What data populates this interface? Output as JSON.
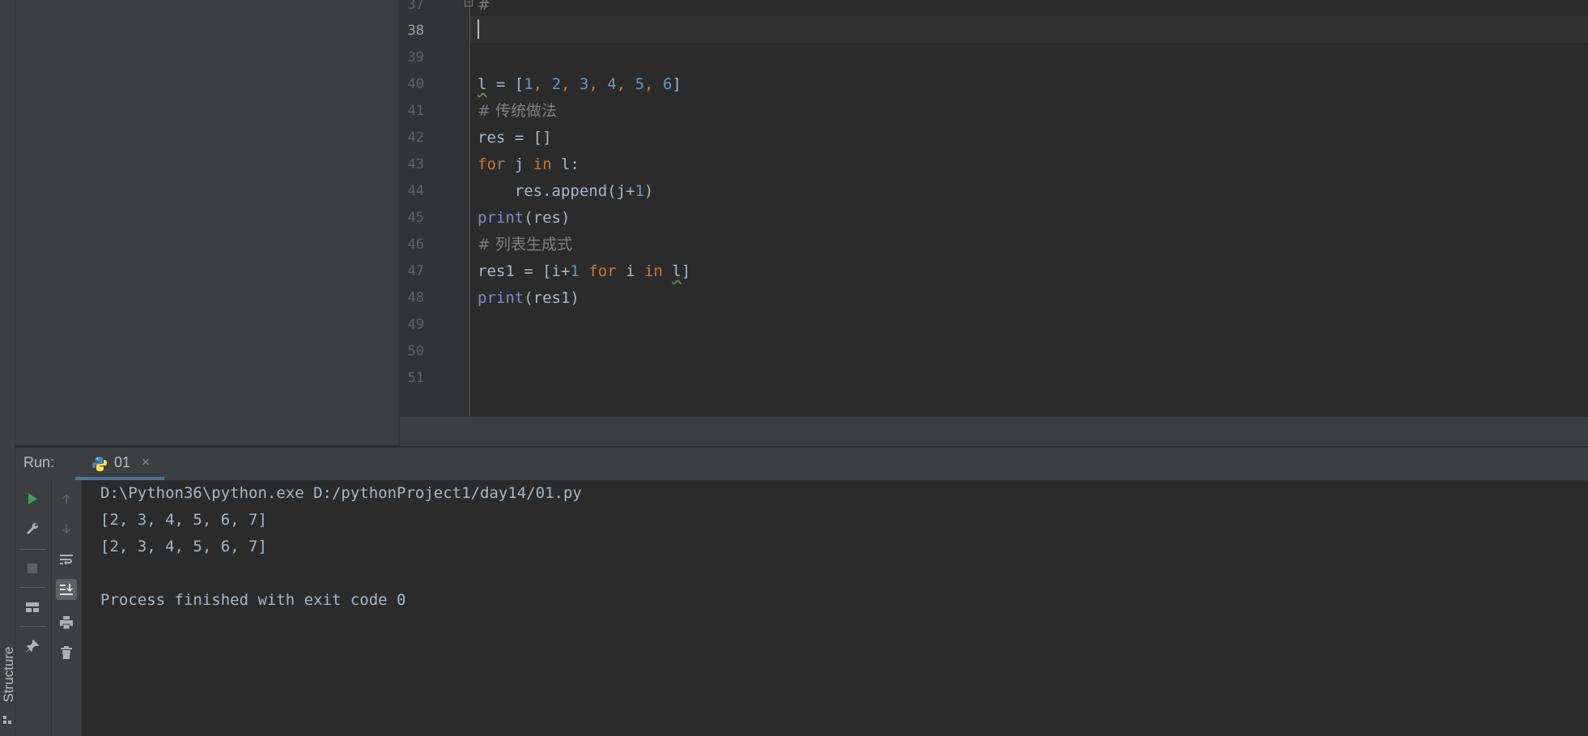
{
  "sidebar": {
    "structure_label": "Structure"
  },
  "editor": {
    "line_numbers": [
      "37",
      "38",
      "39",
      "40",
      "41",
      "42",
      "43",
      "44",
      "45",
      "46",
      "47",
      "48",
      "49",
      "50",
      "51"
    ],
    "current_line": "38",
    "lines": {
      "l37": "#",
      "l40": {
        "var": "l",
        "eq": " = [",
        "n1": "1",
        "n2": "2",
        "n3": "3",
        "n4": "4",
        "n5": "5",
        "n6": "6",
        "end": "]"
      },
      "l41": "# 传统做法",
      "l42": "res = []",
      "l43": {
        "kw_for": "for",
        "mid": " j ",
        "kw_in": "in",
        "rest": " l:"
      },
      "l44": {
        "a": "    res.append(j+",
        "n": "1",
        "b": ")"
      },
      "l45": {
        "fn": "print",
        "rest": "(res)"
      },
      "l46": "# 列表生成式",
      "l47": {
        "a": "res1 = [i+",
        "n": "1",
        "kw_for": "for",
        "mid": " i ",
        "kw_in": "in",
        "var": "l",
        "end": "]"
      },
      "l48": {
        "fn": "print",
        "rest": "(res1)"
      }
    }
  },
  "run_panel": {
    "title": "Run:",
    "tab_label": "01",
    "tab_close": "×",
    "console": [
      "D:\\Python36\\python.exe D:/pythonProject1/day14/01.py",
      "[2, 3, 4, 5, 6, 7]",
      "[2, 3, 4, 5, 6, 7]",
      "",
      "Process finished with exit code 0"
    ],
    "toolbar_icons": [
      "run-icon",
      "wrench-icon",
      "stop-icon",
      "layout-icon",
      "pin-icon",
      "arrow-up-icon",
      "arrow-down-icon",
      "soft-wrap-icon",
      "scroll-to-end-icon",
      "print-icon",
      "trash-icon"
    ]
  },
  "colors": {
    "background": "#2b2b2b",
    "keyword": "#cc7832",
    "number": "#6897bb",
    "comment": "#808080",
    "builtin": "#8888c6",
    "text": "#a9b7c6",
    "run_green": "#499c54"
  }
}
